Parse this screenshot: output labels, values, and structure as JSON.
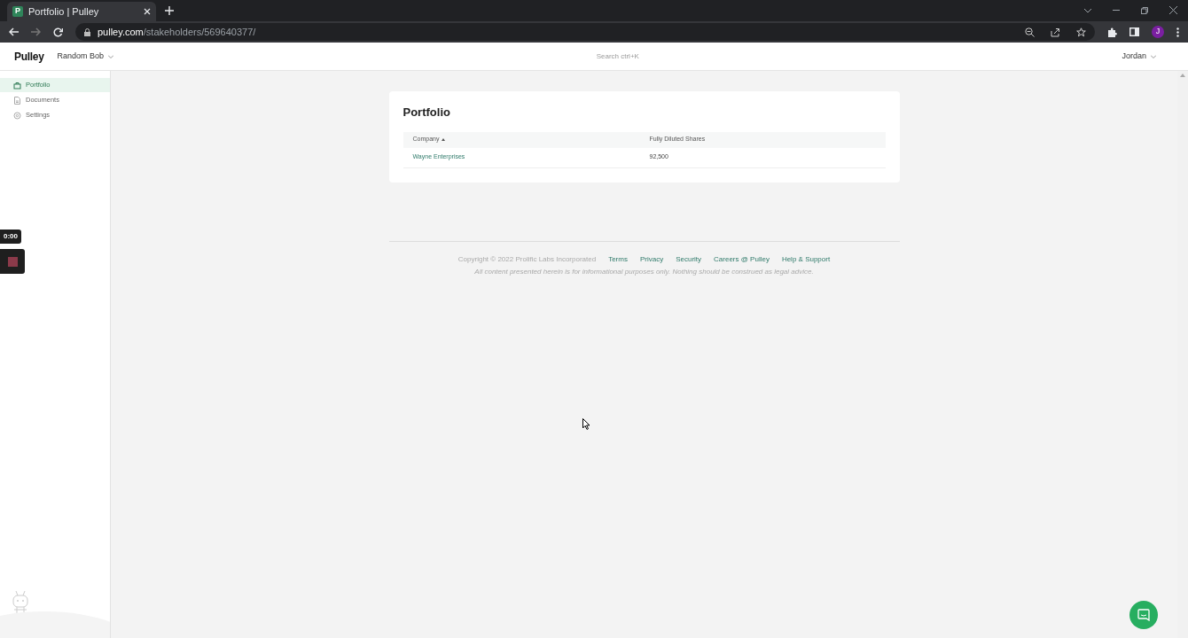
{
  "browser": {
    "tab_title": "Portfolio | Pulley",
    "tab_favicon": "P",
    "url_host": "pulley.com",
    "url_path": "/stakeholders/569640377/",
    "profile_initial": "J"
  },
  "header": {
    "brand": "Pulley",
    "organization": "Random Bob",
    "search": {
      "placeholder": "Search ctrl+K"
    },
    "user": "Jordan"
  },
  "sidebar": {
    "items": [
      {
        "label": "Portfolio",
        "kind": "portfolio",
        "selected": true
      },
      {
        "label": "Documents",
        "kind": "documents",
        "selected": false
      },
      {
        "label": "Settings",
        "kind": "settings",
        "selected": false
      }
    ]
  },
  "recorder": {
    "timer": "0:00"
  },
  "card": {
    "title": "Portfolio",
    "table": {
      "columns": [
        {
          "label": "Company",
          "sorted": true
        },
        {
          "label": "Fully Diluted Shares",
          "sorted": false
        }
      ],
      "rows": [
        [
          "Wayne Enterprises",
          "92,500"
        ]
      ]
    }
  },
  "footer": {
    "copyright": "Copyright © 2022 Prolific Labs Incorporated",
    "links": [
      "Terms",
      "Privacy",
      "Security",
      "Careers @ Pulley",
      "Help & Support"
    ],
    "disclaimer": "All content presented herein is for informational purposes only. Nothing should be construed as legal advice."
  }
}
